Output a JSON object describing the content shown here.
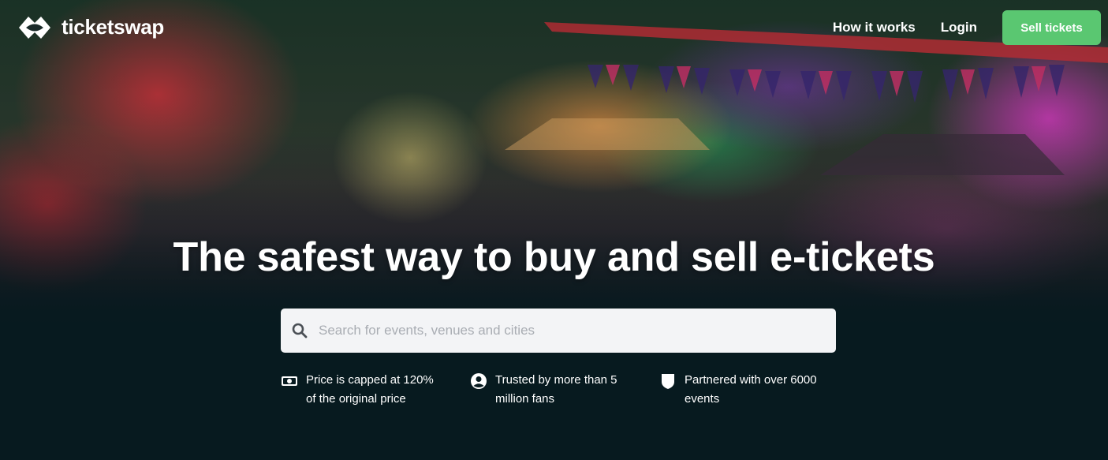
{
  "brand": {
    "name": "ticketswap",
    "accent": "#5ac771",
    "background": "#071a1f"
  },
  "nav": {
    "how_it_works": "How it works",
    "login": "Login",
    "sell_tickets": "Sell tickets"
  },
  "hero": {
    "headline": "The safest way to buy and sell e-tickets"
  },
  "search": {
    "placeholder": "Search for events, venues and cities",
    "icon": "search-icon"
  },
  "features": [
    {
      "icon": "banknote-icon",
      "text": "Price is capped at 120% of the original price"
    },
    {
      "icon": "user-circle-icon",
      "text": "Trusted by more than 5 million fans"
    },
    {
      "icon": "shield-icon",
      "text": "Partnered with over 6000 events"
    }
  ]
}
